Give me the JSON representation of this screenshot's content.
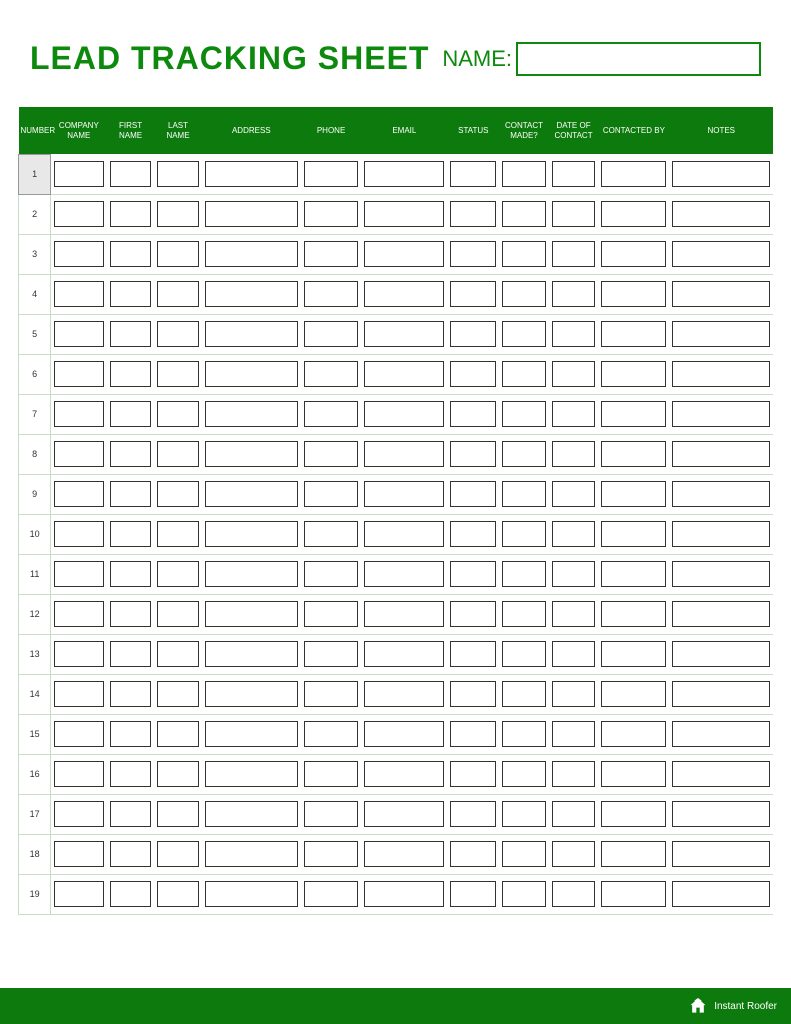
{
  "title": "LEAD TRACKING SHEET",
  "name_label": "NAME:",
  "name_value": "",
  "columns": [
    "NUMBER",
    "COMPANY NAME",
    "FIRST NAME",
    "LAST NAME",
    "ADDRESS",
    "PHONE",
    "EMAIL",
    "STATUS",
    "CONTACT MADE?",
    "DATE OF CONTACT",
    "CONTACTED BY",
    "NOTES"
  ],
  "rows": [
    {
      "number": "1",
      "company": "",
      "first": "",
      "last": "",
      "address": "",
      "phone": "",
      "email": "",
      "status": "",
      "contact_made": "",
      "date_of_contact": "",
      "contacted_by": "",
      "notes": ""
    },
    {
      "number": "2",
      "company": "",
      "first": "",
      "last": "",
      "address": "",
      "phone": "",
      "email": "",
      "status": "",
      "contact_made": "",
      "date_of_contact": "",
      "contacted_by": "",
      "notes": ""
    },
    {
      "number": "3",
      "company": "",
      "first": "",
      "last": "",
      "address": "",
      "phone": "",
      "email": "",
      "status": "",
      "contact_made": "",
      "date_of_contact": "",
      "contacted_by": "",
      "notes": ""
    },
    {
      "number": "4",
      "company": "",
      "first": "",
      "last": "",
      "address": "",
      "phone": "",
      "email": "",
      "status": "",
      "contact_made": "",
      "date_of_contact": "",
      "contacted_by": "",
      "notes": ""
    },
    {
      "number": "5",
      "company": "",
      "first": "",
      "last": "",
      "address": "",
      "phone": "",
      "email": "",
      "status": "",
      "contact_made": "",
      "date_of_contact": "",
      "contacted_by": "",
      "notes": ""
    },
    {
      "number": "6",
      "company": "",
      "first": "",
      "last": "",
      "address": "",
      "phone": "",
      "email": "",
      "status": "",
      "contact_made": "",
      "date_of_contact": "",
      "contacted_by": "",
      "notes": ""
    },
    {
      "number": "7",
      "company": "",
      "first": "",
      "last": "",
      "address": "",
      "phone": "",
      "email": "",
      "status": "",
      "contact_made": "",
      "date_of_contact": "",
      "contacted_by": "",
      "notes": ""
    },
    {
      "number": "8",
      "company": "",
      "first": "",
      "last": "",
      "address": "",
      "phone": "",
      "email": "",
      "status": "",
      "contact_made": "",
      "date_of_contact": "",
      "contacted_by": "",
      "notes": ""
    },
    {
      "number": "9",
      "company": "",
      "first": "",
      "last": "",
      "address": "",
      "phone": "",
      "email": "",
      "status": "",
      "contact_made": "",
      "date_of_contact": "",
      "contacted_by": "",
      "notes": ""
    },
    {
      "number": "10",
      "company": "",
      "first": "",
      "last": "",
      "address": "",
      "phone": "",
      "email": "",
      "status": "",
      "contact_made": "",
      "date_of_contact": "",
      "contacted_by": "",
      "notes": ""
    },
    {
      "number": "11",
      "company": "",
      "first": "",
      "last": "",
      "address": "",
      "phone": "",
      "email": "",
      "status": "",
      "contact_made": "",
      "date_of_contact": "",
      "contacted_by": "",
      "notes": ""
    },
    {
      "number": "12",
      "company": "",
      "first": "",
      "last": "",
      "address": "",
      "phone": "",
      "email": "",
      "status": "",
      "contact_made": "",
      "date_of_contact": "",
      "contacted_by": "",
      "notes": ""
    },
    {
      "number": "13",
      "company": "",
      "first": "",
      "last": "",
      "address": "",
      "phone": "",
      "email": "",
      "status": "",
      "contact_made": "",
      "date_of_contact": "",
      "contacted_by": "",
      "notes": ""
    },
    {
      "number": "14",
      "company": "",
      "first": "",
      "last": "",
      "address": "",
      "phone": "",
      "email": "",
      "status": "",
      "contact_made": "",
      "date_of_contact": "",
      "contacted_by": "",
      "notes": ""
    },
    {
      "number": "15",
      "company": "",
      "first": "",
      "last": "",
      "address": "",
      "phone": "",
      "email": "",
      "status": "",
      "contact_made": "",
      "date_of_contact": "",
      "contacted_by": "",
      "notes": ""
    },
    {
      "number": "16",
      "company": "",
      "first": "",
      "last": "",
      "address": "",
      "phone": "",
      "email": "",
      "status": "",
      "contact_made": "",
      "date_of_contact": "",
      "contacted_by": "",
      "notes": ""
    },
    {
      "number": "17",
      "company": "",
      "first": "",
      "last": "",
      "address": "",
      "phone": "",
      "email": "",
      "status": "",
      "contact_made": "",
      "date_of_contact": "",
      "contacted_by": "",
      "notes": ""
    },
    {
      "number": "18",
      "company": "",
      "first": "",
      "last": "",
      "address": "",
      "phone": "",
      "email": "",
      "status": "",
      "contact_made": "",
      "date_of_contact": "",
      "contacted_by": "",
      "notes": ""
    },
    {
      "number": "19",
      "company": "",
      "first": "",
      "last": "",
      "address": "",
      "phone": "",
      "email": "",
      "status": "",
      "contact_made": "",
      "date_of_contact": "",
      "contacted_by": "",
      "notes": ""
    }
  ],
  "footer": {
    "brand": "Instant Roofer"
  }
}
